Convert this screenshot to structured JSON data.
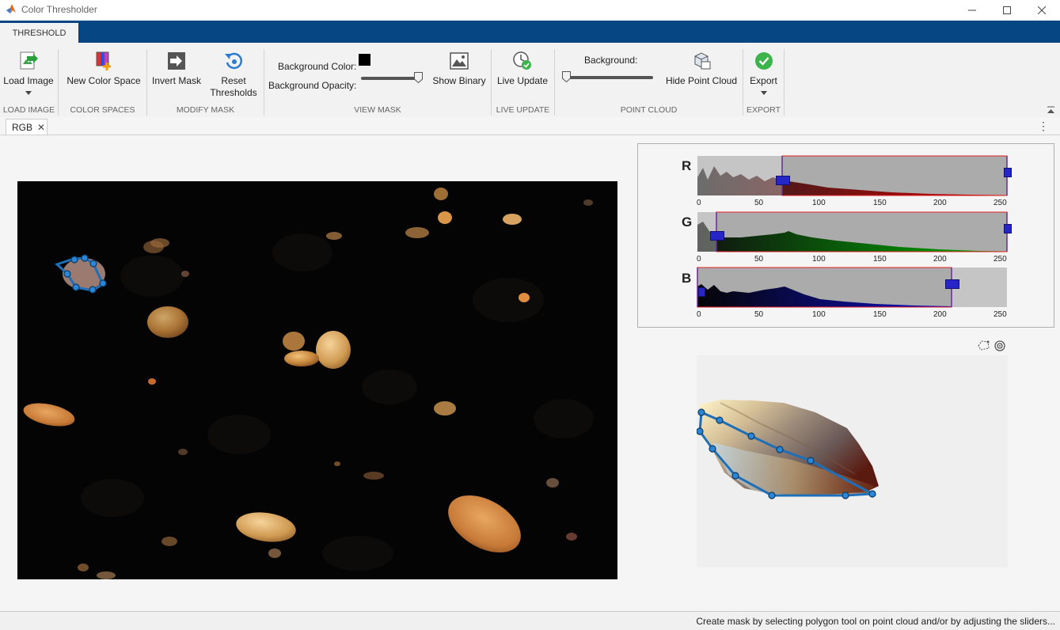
{
  "window": {
    "title": "Color Thresholder"
  },
  "ribbon_tab": "THRESHOLD",
  "toolbar": {
    "load_image": "Load Image",
    "new_color_space": "New Color Space",
    "invert_mask": "Invert Mask",
    "reset_thresholds_1": "Reset",
    "reset_thresholds_2": "Thresholds",
    "background_color": "Background Color:",
    "background_opacity": "Background Opacity:",
    "show_binary": "Show Binary",
    "live_update": "Live Update",
    "background": "Background:",
    "hide_point_cloud": "Hide Point Cloud",
    "export": "Export",
    "background_opacity_value": 1.0,
    "point_cloud_background_value": 0.0
  },
  "groups": {
    "load_image": "LOAD IMAGE",
    "color_spaces": "COLOR SPACES",
    "modify_mask": "MODIFY MASK",
    "view_mask": "VIEW MASK",
    "live_update": "LIVE UPDATE",
    "point_cloud": "POINT CLOUD",
    "export": "EXPORT"
  },
  "document_tab": "RGB",
  "histograms": {
    "ticks": [
      "0",
      "50",
      "100",
      "150",
      "200",
      "250"
    ],
    "channels": [
      {
        "label": "R",
        "min": 70,
        "max": 255,
        "color": "#b00000"
      },
      {
        "label": "G",
        "min": 15,
        "max": 255,
        "color": "#008000"
      },
      {
        "label": "B",
        "min": 0,
        "max": 210,
        "color": "#0a0a80"
      }
    ]
  },
  "status": {
    "text": "Create mask by selecting polygon tool on point cloud and/or by adjusting the sliders..."
  },
  "colors": {
    "accent": "#064783",
    "thumb": "#2626c8"
  }
}
